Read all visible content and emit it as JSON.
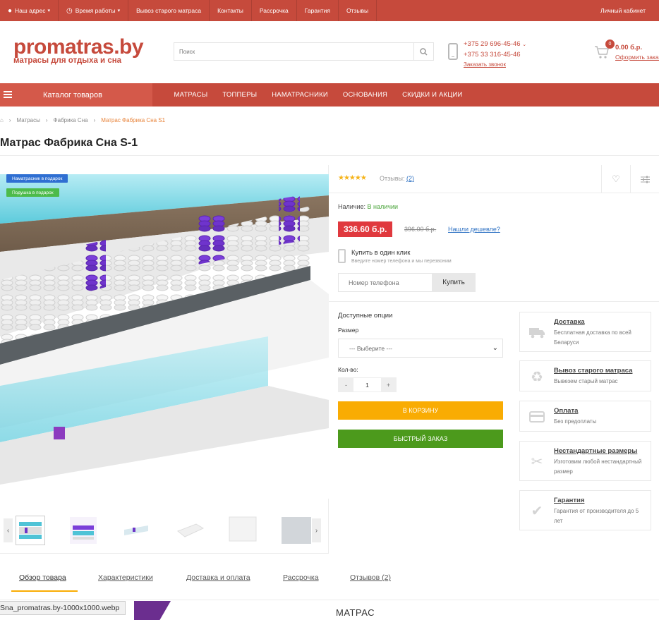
{
  "topbar": {
    "address": "Наш адрес",
    "hours": "Время работы",
    "removal": "Вывоз старого матраса",
    "contacts": "Контакты",
    "installment": "Рассрочка",
    "warranty": "Гарантия",
    "reviews": "Отзывы",
    "account": "Личный кабинет"
  },
  "header": {
    "logo_name": "promatras.by",
    "logo_tagline": "матрасы для отдыха и сна",
    "search_placeholder": "Поиск",
    "phone1": "+375 29 696-45-46",
    "phone2": "+375 33 316-45-46",
    "callback": "Заказать звонок",
    "cart_count": "0",
    "cart_sum": "0.00 б.р.",
    "cart_order": "Оформить заказ"
  },
  "nav": {
    "catalog": "Каталог товаров",
    "items": [
      "МАТРАСЫ",
      "ТОППЕРЫ",
      "НАМАТРАСНИКИ",
      "ОСНОВАНИЯ",
      "СКИДКИ И АКЦИИ"
    ]
  },
  "breadcrumbs": [
    "Матрасы",
    "Фабрика Сна",
    "Матрас Фабрика Сна S1"
  ],
  "product": {
    "title": "Матрас Фабрика Сна S-1",
    "badges": [
      "Наматрасник в подарок",
      "Подушка в подарок"
    ],
    "stars": "★★★★★",
    "reviews_label": "Отзывы:",
    "reviews_count": "(2)",
    "availability_label": "Наличие:",
    "availability_value": "В наличии",
    "price": "336.60 б.р.",
    "old_price": "396.00 б.р.",
    "cheaper": "Нашли дешевле?",
    "one_click_title": "Купить в один клик",
    "one_click_hint": "Введите номер телефона и мы перезвоним",
    "phone_placeholder": "Номер телефона",
    "buy_label": "Купить",
    "options_title": "Доступные опции",
    "size_label": "Размер",
    "size_value": "--- Выберите ---",
    "qty_label": "Кол-во:",
    "qty_value": "1",
    "to_cart": "В КОРЗИНУ",
    "fast_order": "БЫСТРЫЙ ЗАКАЗ"
  },
  "features": [
    {
      "icon": "truck-icon",
      "title": "Доставка",
      "desc": "Бесплатная доставка по всей Беларуси"
    },
    {
      "icon": "recycle-icon",
      "title": "Вывоз старого матраса",
      "desc": "Вывезем старый матрас"
    },
    {
      "icon": "credit-card-icon",
      "title": "Оплата",
      "desc": "Без предоплаты"
    },
    {
      "icon": "scissors-icon",
      "title": "Нестандартные размеры",
      "desc": "Изготовим любой нестандартный размер"
    },
    {
      "icon": "check-icon",
      "title": "Гарантия",
      "desc": "Гарантия от производителя до 5 лет"
    }
  ],
  "tabs": [
    "Обзор товара",
    "Характеристики",
    "Доставка и оплата",
    "Рассрочка",
    "Отзывов (2)"
  ],
  "status_url": "Sna_promatras.by-1000x1000.webp",
  "section_heading": "МАТРАС",
  "colors": {
    "brand": "#c64a3c",
    "cart_button": "#f9ac03",
    "fast_button": "#4c9a1c",
    "price_badge": "#e0393e"
  }
}
